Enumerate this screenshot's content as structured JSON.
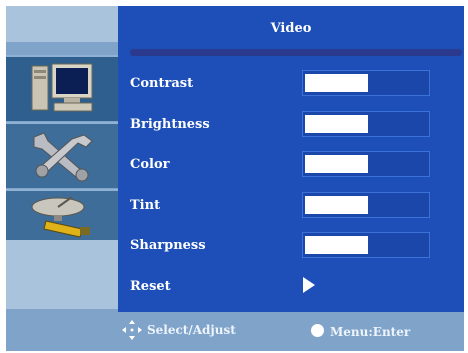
{
  "menu": {
    "title": "Video",
    "items": [
      {
        "label": "Contrast",
        "level": 0.52
      },
      {
        "label": "Brightness",
        "level": 0.52
      },
      {
        "label": "Color",
        "level": 0.52
      },
      {
        "label": "Tint",
        "level": 0.52
      },
      {
        "label": "Sharpness",
        "level": 0.52
      }
    ],
    "reset_label": "Reset"
  },
  "sidebar": {
    "icons": [
      "computer-icon",
      "tools-icon",
      "satellite-dish-icon"
    ]
  },
  "footer": {
    "select_hint": "Select/Adjust",
    "menu_hint": "Menu:Enter"
  },
  "colors": {
    "panel": "#1e4fb8",
    "sidebar": "#7fa3c9",
    "slider_fill": "#ffffff"
  }
}
